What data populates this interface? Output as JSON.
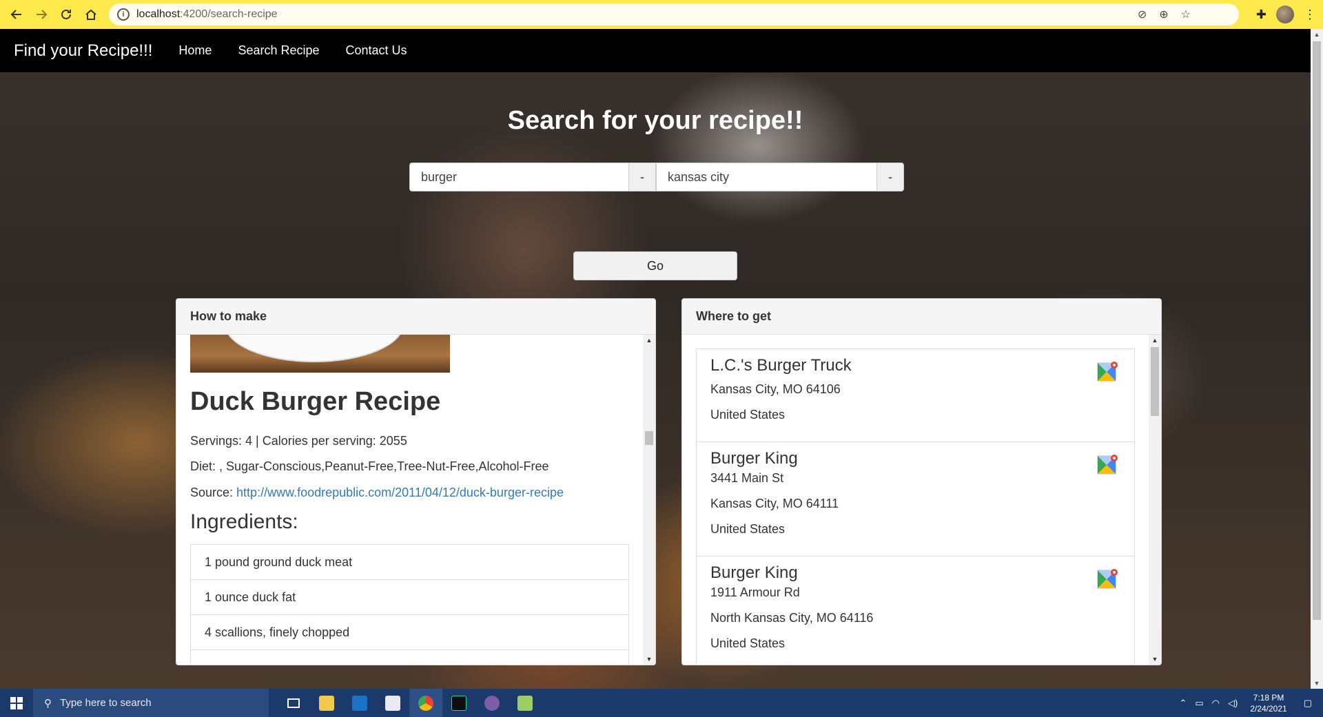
{
  "browser": {
    "url_host": "localhost",
    "url_path": ":4200/search-recipe"
  },
  "navbar": {
    "brand": "Find your Recipe!!!",
    "links": [
      "Home",
      "Search Recipe",
      "Contact Us"
    ]
  },
  "page": {
    "title": "Search for your recipe!!",
    "search": {
      "query_value": "burger",
      "location_value": "kansas city",
      "clear_label": "-",
      "go_label": "Go"
    }
  },
  "how_to_make": {
    "heading": "How to make",
    "recipe_title": "Duck Burger Recipe",
    "servings_line": "Servings: 4 | Calories per serving: 2055",
    "diet_line": "Diet: , Sugar-Conscious,Peanut-Free,Tree-Nut-Free,Alcohol-Free",
    "source_label": "Source: ",
    "source_url": "http://www.foodrepublic.com/2011/04/12/duck-burger-recipe",
    "ingredients_title": "Ingredients:",
    "ingredients": [
      "1 pound ground duck meat",
      "1 ounce duck fat",
      "4 scallions, finely chopped"
    ]
  },
  "where_to_get": {
    "heading": "Where to get",
    "stores": [
      {
        "name": "L.C.'s Burger Truck",
        "lines": [
          "Kansas City, MO 64106",
          "United States"
        ]
      },
      {
        "name": "Burger King",
        "lines": [
          "3441 Main St",
          "Kansas City, MO 64111",
          "United States"
        ]
      },
      {
        "name": "Burger King",
        "lines": [
          "1911 Armour Rd",
          "North Kansas City, MO 64116",
          "United States"
        ]
      }
    ]
  },
  "taskbar": {
    "search_placeholder": "Type here to search",
    "time": "7:18 PM",
    "date": "2/24/2021"
  },
  "icons": {
    "map": "google-maps-icon",
    "back": "arrow-left-icon",
    "forward": "arrow-right-icon",
    "reload": "reload-icon",
    "home": "home-icon"
  }
}
